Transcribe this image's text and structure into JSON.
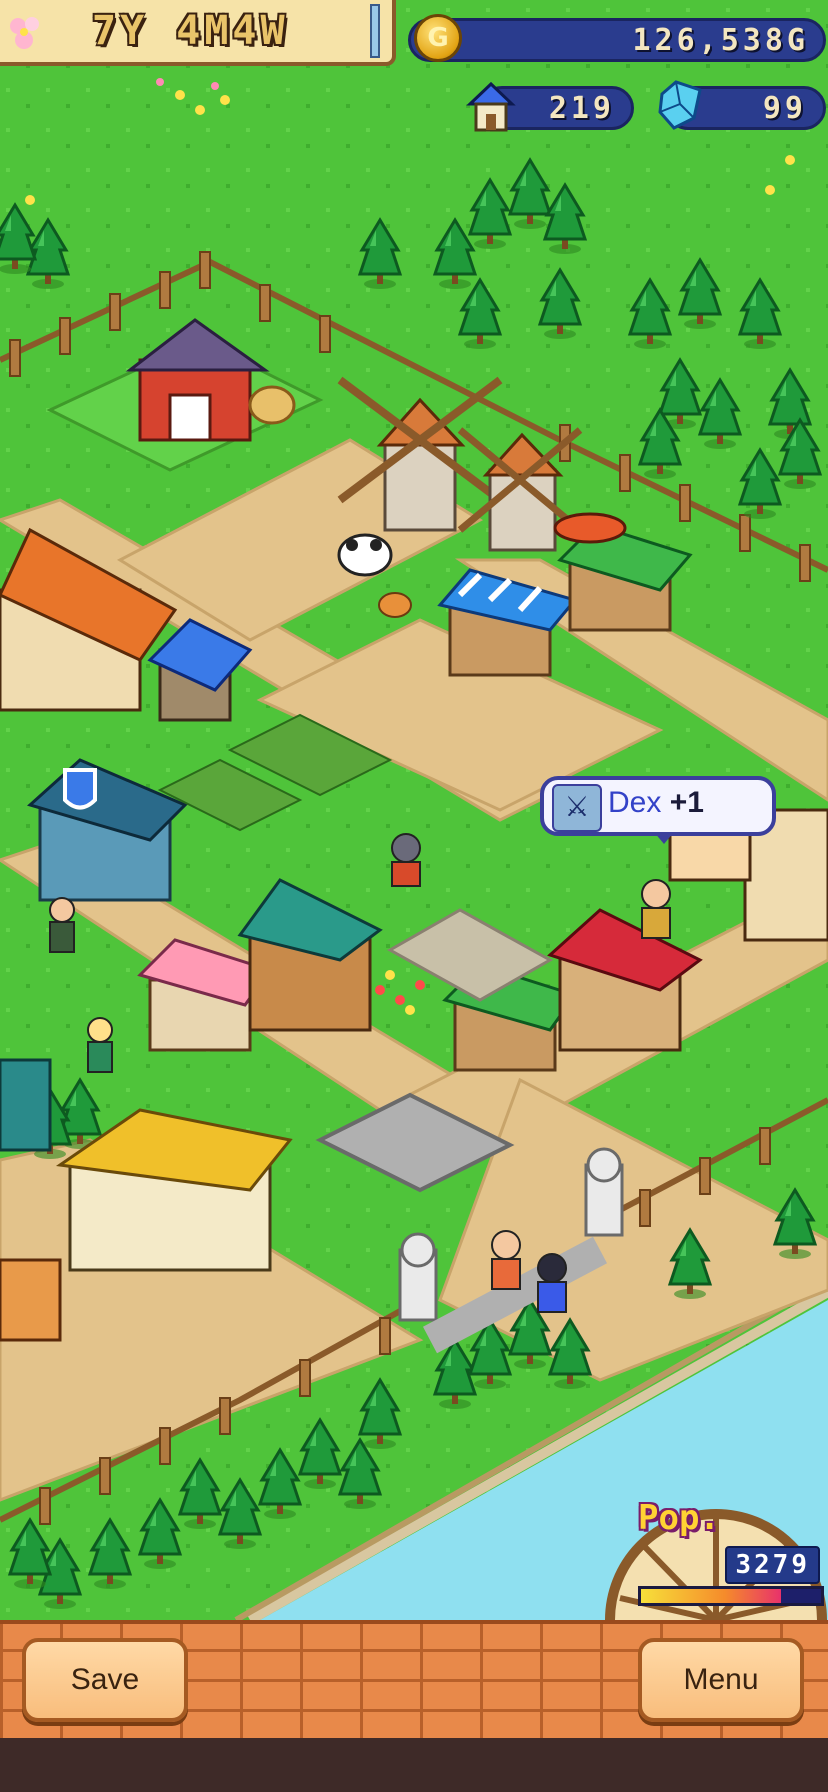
{
  "hud": {
    "date": "7Y 4M4W",
    "gold": "126,538G",
    "gold_icon": "coin-icon",
    "houses": "219",
    "house_icon": "house-icon",
    "crystals": "99",
    "crystal_icon": "crystal-icon"
  },
  "popup": {
    "stat": "Dex",
    "change": "+1",
    "icon": "crossed-swords-icon"
  },
  "population": {
    "label": "Pop.",
    "value": "3279",
    "bar_fill": 0.78
  },
  "toolbar": {
    "save_label": "Save",
    "menu_label": "Menu"
  },
  "colors": {
    "grass": "#4fc43a",
    "path": "#e3c38b",
    "water": "#8fe0f0",
    "brick": "#e8894a"
  }
}
